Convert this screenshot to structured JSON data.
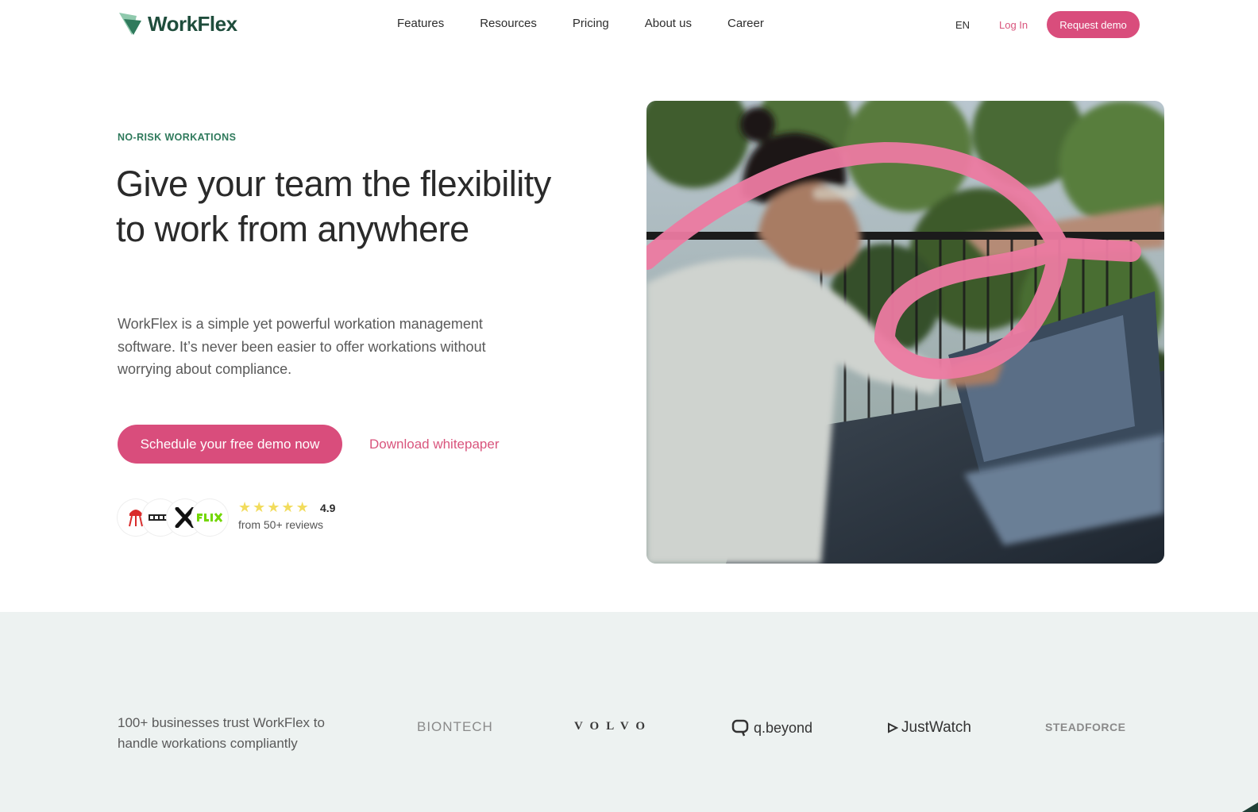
{
  "nav": {
    "brand": "WorkFlex",
    "links": [
      "Features",
      "Resources",
      "Pricing",
      "About us",
      "Career"
    ],
    "lang": "EN",
    "login": "Log In",
    "request_demo": "Request demo"
  },
  "hero": {
    "eyebrow": "NO-RISK WORKATIONS",
    "headline": "Give your team the flexibility to work from anywhere",
    "subtext": "WorkFlex is a simple yet powerful workation management software. It’s never been easier to offer workations without worrying about compliance.",
    "cta_primary": "Schedule your free demo now",
    "cta_secondary": "Download whitepaper",
    "rating": "4.9",
    "stars": 5,
    "reviews": "from 50+ reviews",
    "review_logos": [
      "weber-logo",
      "cariad-logo",
      "x-logo",
      "flix-logo"
    ]
  },
  "trust": {
    "text": "100+ businesses trust WorkFlex to handle workations compliantly",
    "brands": [
      "BIONTECH",
      "VOLVO",
      "q.beyond",
      "JustWatch",
      "STEADFORCE"
    ]
  },
  "colors": {
    "accent": "#d94d7c",
    "brand_green": "#1f4d3c",
    "eyebrow_green": "#2f7a5c",
    "trust_bg": "#edf2f1"
  }
}
